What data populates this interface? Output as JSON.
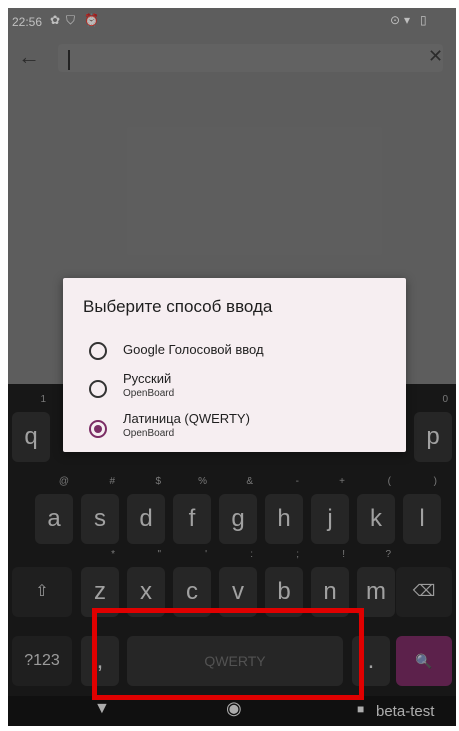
{
  "status_bar": {
    "time": "22:56"
  },
  "search": {
    "back_icon": "arrow-back-icon",
    "close_icon": "close-icon"
  },
  "dialog": {
    "title": "Выберите способ ввода",
    "options": [
      {
        "label": "Google Голосовой ввод",
        "sub": "",
        "selected": false
      },
      {
        "label": "Русский",
        "sub": "OpenBoard",
        "selected": false
      },
      {
        "label": "Латиница (QWERTY)",
        "sub": "OpenBoard",
        "selected": true
      }
    ]
  },
  "keyboard": {
    "row1_visible": [
      "q",
      "p"
    ],
    "row2": [
      "a",
      "s",
      "d",
      "f",
      "g",
      "h",
      "j",
      "k",
      "l"
    ],
    "row2_hints": [
      "@",
      "#",
      "$",
      "%",
      "&",
      "-",
      "+",
      "(",
      ")"
    ],
    "row3": [
      "z",
      "x",
      "c",
      "v",
      "b",
      "n",
      "m"
    ],
    "row3_hints": [
      "*",
      "\"",
      "'",
      ":",
      ";",
      "!",
      "?"
    ],
    "symbols_label": "?123",
    "comma": ",",
    "space_label": "QWERTY",
    "period": ".",
    "shift_icon": "shift-icon",
    "delete_icon": "backspace-icon",
    "search_icon": "search-icon",
    "accent_color": "#7b2d65"
  },
  "nav": {
    "right_label": "beta-test"
  },
  "colors": {
    "highlight": "#e00000",
    "selected_radio": "#7b2d65"
  }
}
